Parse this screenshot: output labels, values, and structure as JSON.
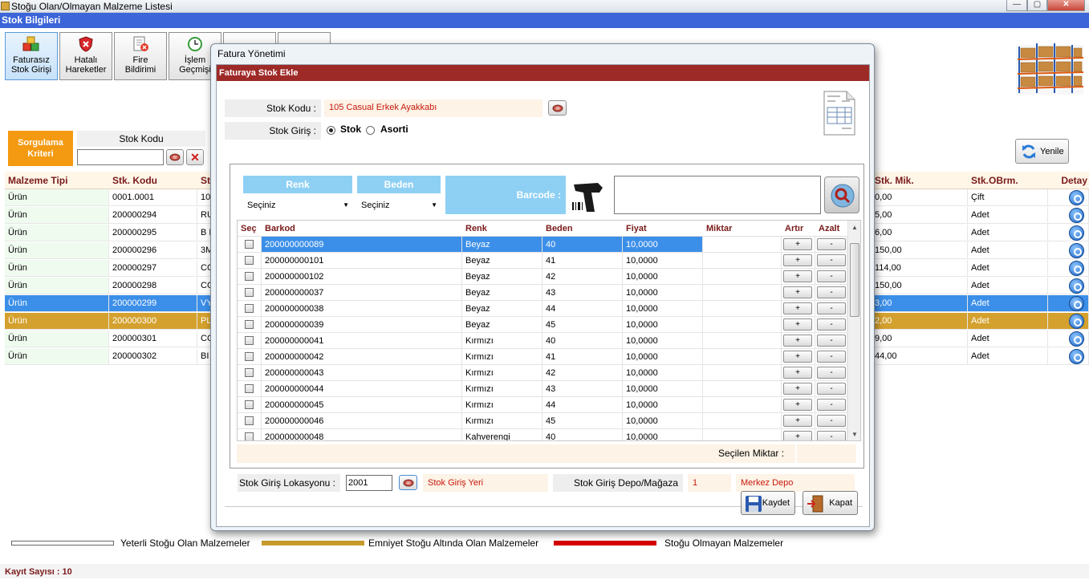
{
  "window": {
    "title": "Stoğu Olan/Olmayan Malzeme Listesi",
    "header": "Stok Bilgileri",
    "min": "—",
    "max": "▢",
    "close": "✕"
  },
  "toolbar": [
    {
      "label1": "Faturasız",
      "label2": "Stok Girişi"
    },
    {
      "label1": "Hatalı",
      "label2": "Hareketler"
    },
    {
      "label1": "Fire",
      "label2": "Bildirimi"
    },
    {
      "label1": "İşlem",
      "label2": "Geçmişi"
    }
  ],
  "filter": {
    "sorgulama_line1": "Sorgulama",
    "sorgulama_line2": "Kriteri",
    "stok_kodu_label": "Stok Kodu",
    "stok_kodu_value": "",
    "clear_icon": "✕"
  },
  "yenile_label": "Yenile",
  "main_grid": {
    "headers": {
      "tip": "Malzeme Tipi",
      "kod": "Stk. Kodu",
      "ad": "St",
      "mik": "Stk. Mik.",
      "obrm": "Stk.OBrm.",
      "detay": "Detay"
    },
    "rows": [
      {
        "tip": "Ürün",
        "kod": "0001.0001",
        "ad": "10",
        "mik": "0,00",
        "obrm": "Çift"
      },
      {
        "tip": "Ürün",
        "kod": "200000294",
        "ad": "RU",
        "mik": "5,00",
        "obrm": "Adet"
      },
      {
        "tip": "Ürün",
        "kod": "200000295",
        "ad": "B I",
        "mik": "6,00",
        "obrm": "Adet"
      },
      {
        "tip": "Ürün",
        "kod": "200000296",
        "ad": "3M",
        "mik": "150,00",
        "obrm": "Adet"
      },
      {
        "tip": "Ürün",
        "kod": "200000297",
        "ad": "CO",
        "mik": "114,00",
        "obrm": "Adet"
      },
      {
        "tip": "Ürün",
        "kod": "200000298",
        "ad": "CO",
        "mik": "150,00",
        "obrm": "Adet"
      },
      {
        "tip": "Ürün",
        "kod": "200000299",
        "ad": "VY",
        "mik": "3,00",
        "obrm": "Adet"
      },
      {
        "tip": "Ürün",
        "kod": "200000300",
        "ad": "PL",
        "mik": "2,00",
        "obrm": "Adet"
      },
      {
        "tip": "Ürün",
        "kod": "200000301",
        "ad": "CO",
        "mik": "9,00",
        "obrm": "Adet"
      },
      {
        "tip": "Ürün",
        "kod": "200000302",
        "ad": "BI",
        "mik": "44,00",
        "obrm": "Adet"
      }
    ]
  },
  "legend": {
    "yeterli": "Yeterli Stoğu Olan Malzemeler",
    "emniyet": "Emniyet Stoğu Altında Olan Malzemeler",
    "olmayan": "Stoğu Olmayan Malzemeler"
  },
  "kayit_sayisi": "Kayıt Sayısı : 10",
  "colors": {
    "selected_blue": "#3c8fe8",
    "selected_gold": "#d4a12e",
    "dialog_red": "#9e2a28",
    "label_blue": "#8ed0f4",
    "legend_gold": "#c99a2e",
    "legend_red": "#d40000"
  },
  "dialog": {
    "title": "Fatura Yönetimi",
    "section": "Faturaya Stok Ekle",
    "stok_kodu_label": "Stok Kodu :",
    "stok_kodu_value": "105 Casual Erkek Ayakkabı",
    "stok_giris_label": "Stok Giriş :",
    "radio_stok": "Stok",
    "radio_asorti": "Asorti",
    "renk_label": "Renk",
    "beden_label": "Beden",
    "barcode_label": "Barcode :",
    "renk_value": "Seçiniz",
    "beden_value": "Seçiniz",
    "barcode_value": "",
    "grid_headers": {
      "sec": "Seç",
      "barkod": "Barkod",
      "renk": "Renk",
      "beden": "Beden",
      "fiyat": "Fiyat",
      "miktar": "Miktar",
      "artir": "Artır",
      "azalt": "Azalt"
    },
    "rows": [
      {
        "barkod": "200000000089",
        "renk": "Beyaz",
        "beden": "40",
        "fiyat": "10,0000"
      },
      {
        "barkod": "200000000101",
        "renk": "Beyaz",
        "beden": "41",
        "fiyat": "10,0000"
      },
      {
        "barkod": "200000000102",
        "renk": "Beyaz",
        "beden": "42",
        "fiyat": "10,0000"
      },
      {
        "barkod": "200000000037",
        "renk": "Beyaz",
        "beden": "43",
        "fiyat": "10,0000"
      },
      {
        "barkod": "200000000038",
        "renk": "Beyaz",
        "beden": "44",
        "fiyat": "10,0000"
      },
      {
        "barkod": "200000000039",
        "renk": "Beyaz",
        "beden": "45",
        "fiyat": "10,0000"
      },
      {
        "barkod": "200000000041",
        "renk": "Kırmızı",
        "beden": "40",
        "fiyat": "10,0000"
      },
      {
        "barkod": "200000000042",
        "renk": "Kırmızı",
        "beden": "41",
        "fiyat": "10,0000"
      },
      {
        "barkod": "200000000043",
        "renk": "Kırmızı",
        "beden": "42",
        "fiyat": "10,0000"
      },
      {
        "barkod": "200000000044",
        "renk": "Kırmızı",
        "beden": "43",
        "fiyat": "10,0000"
      },
      {
        "barkod": "200000000045",
        "renk": "Kırmızı",
        "beden": "44",
        "fiyat": "10,0000"
      },
      {
        "barkod": "200000000046",
        "renk": "Kırmızı",
        "beden": "45",
        "fiyat": "10,0000"
      },
      {
        "barkod": "200000000048",
        "renk": "Kahverengi",
        "beden": "40",
        "fiyat": "10,0000"
      }
    ],
    "plus": "+",
    "minus": "-",
    "secilen_label": "Seçilen Miktar :",
    "lokasyon_label": "Stok Giriş Lokasyonu :",
    "lokasyon_value": "2001",
    "lokasyon_name": "Stok Giriş Yeri",
    "depo_label": "Stok Giriş Depo/Mağaza",
    "depo_kod": "1",
    "depo_name": "Merkez Depo",
    "kaydet": "Kaydet",
    "kapat": "Kapat"
  }
}
